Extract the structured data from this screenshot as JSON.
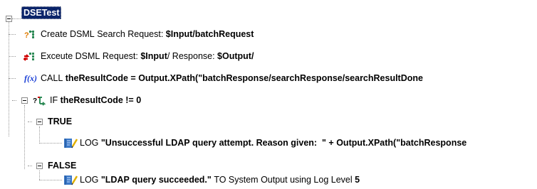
{
  "tree": {
    "root": {
      "label": "DSETest"
    },
    "nodes": [
      {
        "icon": "dsml-search-icon",
        "parts": [
          [
            "Create DSML Search Request: ",
            false
          ],
          [
            "$Input/batchRequest",
            true
          ]
        ]
      },
      {
        "icon": "dsml-execute-icon",
        "parts": [
          [
            "Exceute DSML Request: ",
            false
          ],
          [
            "$Input",
            true
          ],
          [
            "/ Response: ",
            false
          ],
          [
            "$Output/",
            true
          ]
        ]
      },
      {
        "icon": "function-icon",
        "parts": [
          [
            "CALL ",
            false
          ],
          [
            "theResultCode = Output.XPath(\"batchResponse/searchResponse/searchResultDone",
            true
          ]
        ]
      },
      {
        "icon": "if-branch-icon",
        "parts": [
          [
            "IF ",
            false
          ],
          [
            "theResultCode != 0",
            true
          ]
        ]
      },
      {
        "label": "TRUE"
      },
      {
        "icon": "log-icon",
        "parts": [
          [
            "LOG ",
            false
          ],
          [
            "\"Unsuccessful LDAP query attempt. Reason given:  \" + Output.XPath(\"batchResponse",
            true
          ]
        ]
      },
      {
        "label": "FALSE"
      },
      {
        "icon": "log-icon",
        "parts": [
          [
            "LOG ",
            false
          ],
          [
            "\"LDAP query succeeded.\"",
            true
          ],
          [
            " TO System Output using Log Level ",
            false
          ],
          [
            "5",
            true
          ]
        ]
      }
    ]
  }
}
